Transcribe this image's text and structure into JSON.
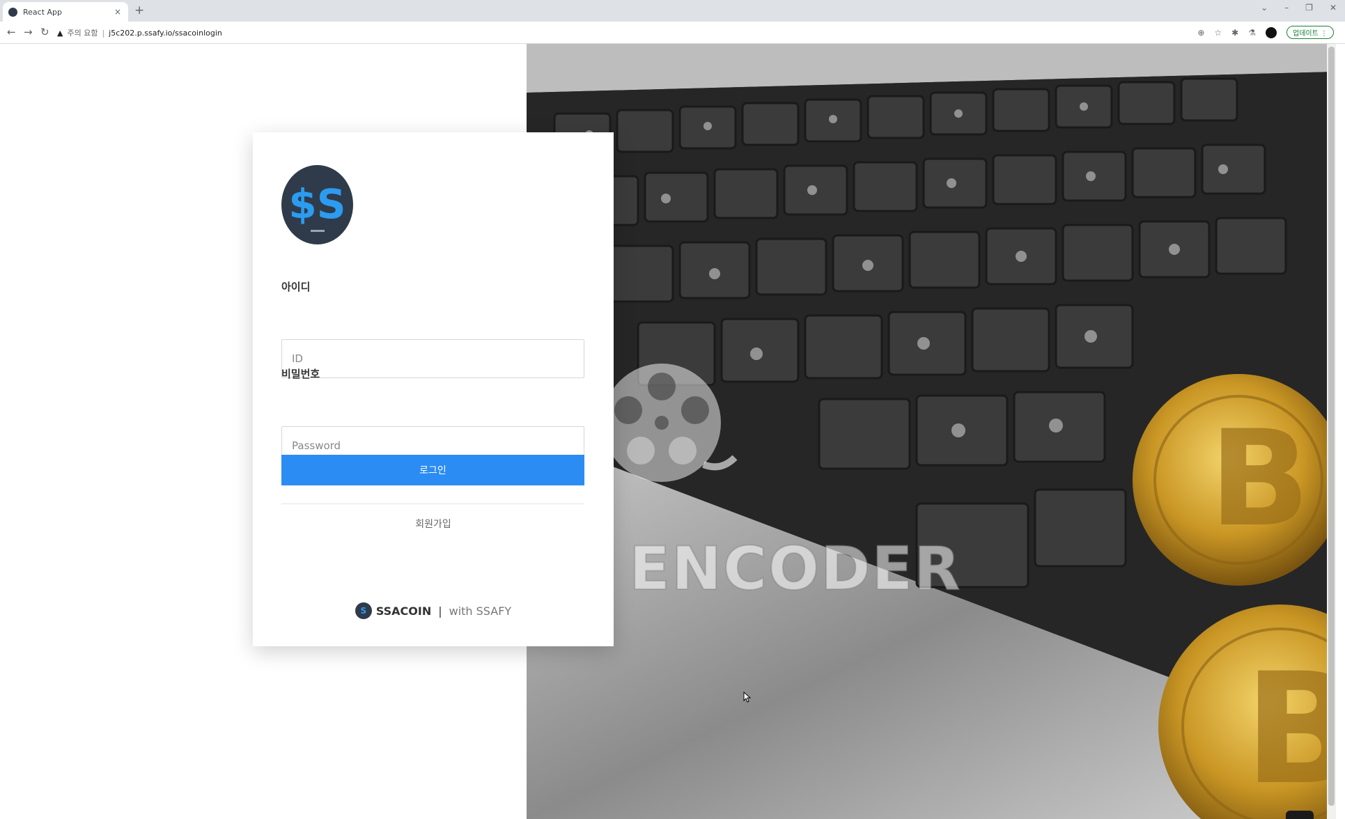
{
  "browser": {
    "tab_title": "React App",
    "tab_close": "×",
    "new_tab": "+",
    "window_controls": [
      "⌄",
      "–",
      "❐",
      "✕"
    ],
    "nav": {
      "back": "←",
      "forward": "→",
      "reload": "↻"
    },
    "security_warning": "주의 요함",
    "url": "j5c202.p.ssafy.io/ssacoinlogin",
    "update_label": "업데이트"
  },
  "login": {
    "logo_icon": "ssacoin-logo",
    "id_label": "아이디",
    "id_placeholder": "ID",
    "password_label": "비밀번호",
    "password_placeholder": "Password",
    "login_button": "로그인",
    "signup_link": "회원가입"
  },
  "footer": {
    "brand": "SSACOIN",
    "separator": "|",
    "with_text": "with SSAFY"
  },
  "watermark": {
    "text": "GOM ENCODER"
  },
  "scroll_top_button": "↑",
  "colors": {
    "accent": "#2b8cf3",
    "logo_dark": "#2f3b4a",
    "logo_blue": "#2b9cf0"
  }
}
